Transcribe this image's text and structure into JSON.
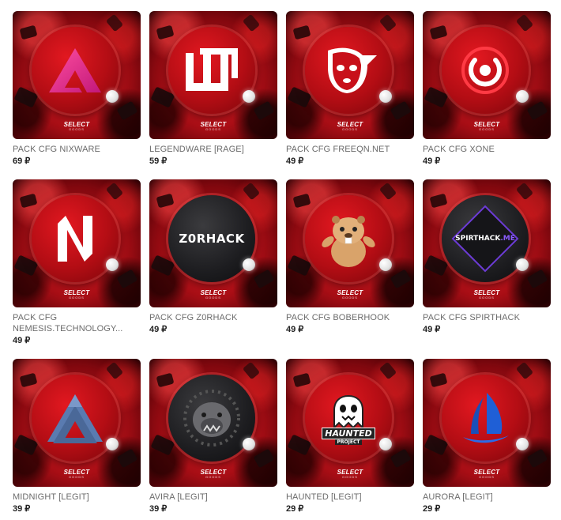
{
  "brand": {
    "name": "SELECT",
    "tagline": "GOODS"
  },
  "currency": "₽",
  "products": [
    {
      "title": "PACK CFG NIXWARE",
      "price": "69 ₽",
      "logo": "nixware-triangle-icon"
    },
    {
      "title": "LEGENDWARE [RAGE]",
      "price": "59 ₽",
      "logo": "legendware-lw-icon"
    },
    {
      "title": "PACK CFG FREEQN.NET",
      "price": "49 ₽",
      "logo": "freeqn-mask-icon"
    },
    {
      "title": "PACK CFG XONE",
      "price": "49 ₽",
      "logo": "xone-ring-icon"
    },
    {
      "title": "PACK CFG NEMESIS.TECHNOLOGY...",
      "price": "49 ₽",
      "logo": "nemesis-n-icon"
    },
    {
      "title": "PACK CFG Z0RHACK",
      "price": "49 ₽",
      "logo": "z0rhack-text-logo",
      "logo_text": "Z0RHACK"
    },
    {
      "title": "PACK CFG BOBERHOOK",
      "price": "49 ₽",
      "logo": "beaver-icon"
    },
    {
      "title": "PACK CFG SPIRTHACK",
      "price": "49 ₽",
      "logo": "spirthack-diamond-logo",
      "logo_text": "SPIRTHACK",
      "logo_suffix": ".ME"
    },
    {
      "title": "MIDNIGHT [LEGIT]",
      "price": "39 ₽",
      "logo": "midnight-penrose-triangle-icon"
    },
    {
      "title": "AVIRA [LEGIT]",
      "price": "39 ₽",
      "logo": "avira-bulldog-icon"
    },
    {
      "title": "HAUNTED [LEGIT]",
      "price": "29 ₽",
      "logo": "haunted-ghost-icon",
      "logo_text": "HAUNTED",
      "logo_sub": "PROJECT"
    },
    {
      "title": "AURORA [LEGIT]",
      "price": "29 ₽",
      "logo": "aurora-sail-icon"
    }
  ]
}
